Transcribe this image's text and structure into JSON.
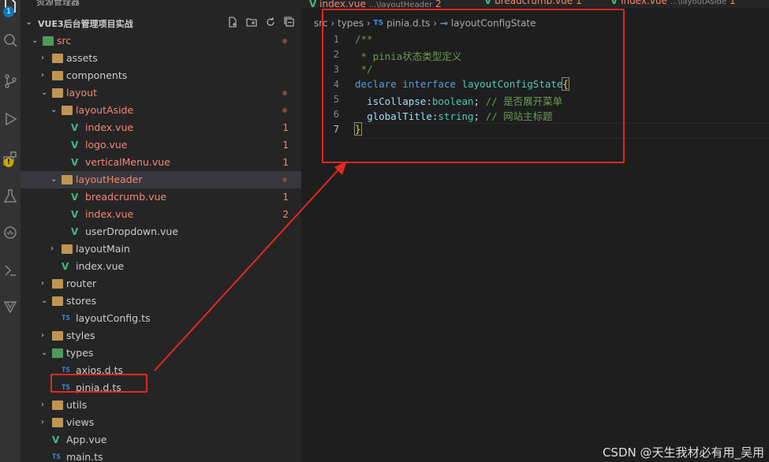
{
  "explorer": {
    "title": "资源管理器",
    "project": "VUE3后台管理项目实战",
    "activity_badge": "1"
  },
  "tabs": [
    {
      "name": "index.vue",
      "path": "...\\layoutHeader",
      "count": "2"
    },
    {
      "name": "breadcrumb.vue",
      "path": "",
      "count": "1"
    },
    {
      "name": "index.vue",
      "path": "...\\layoutAside",
      "count": "1"
    }
  ],
  "tree": [
    {
      "label": "src",
      "kind": "folder-src",
      "depth": 0,
      "open": true,
      "status": "dot",
      "color": "red"
    },
    {
      "label": "assets",
      "kind": "folder",
      "depth": 1,
      "open": false,
      "status": "",
      "color": "white"
    },
    {
      "label": "components",
      "kind": "folder",
      "depth": 1,
      "open": false,
      "status": "",
      "color": "white"
    },
    {
      "label": "layout",
      "kind": "folder",
      "depth": 1,
      "open": true,
      "status": "dot",
      "color": "red"
    },
    {
      "label": "layoutAside",
      "kind": "folder",
      "depth": 2,
      "open": true,
      "status": "dot",
      "color": "red"
    },
    {
      "label": "index.vue",
      "kind": "vue",
      "depth": 3,
      "status": "1",
      "color": "red"
    },
    {
      "label": "logo.vue",
      "kind": "vue",
      "depth": 3,
      "status": "1",
      "color": "red"
    },
    {
      "label": "verticalMenu.vue",
      "kind": "vue",
      "depth": 3,
      "status": "1",
      "color": "red"
    },
    {
      "label": "layoutHeader",
      "kind": "folder",
      "depth": 2,
      "open": true,
      "status": "dot",
      "color": "red",
      "selected": true
    },
    {
      "label": "breadcrumb.vue",
      "kind": "vue",
      "depth": 3,
      "status": "1",
      "color": "red"
    },
    {
      "label": "index.vue",
      "kind": "vue",
      "depth": 3,
      "status": "2",
      "color": "red"
    },
    {
      "label": "userDropdown.vue",
      "kind": "vue",
      "depth": 3,
      "status": "",
      "color": "white"
    },
    {
      "label": "layoutMain",
      "kind": "folder",
      "depth": 2,
      "open": false,
      "status": "",
      "color": "white"
    },
    {
      "label": "index.vue",
      "kind": "vue",
      "depth": 2,
      "status": "",
      "color": "white"
    },
    {
      "label": "router",
      "kind": "folder",
      "depth": 1,
      "open": false,
      "status": "",
      "color": "white"
    },
    {
      "label": "stores",
      "kind": "folder",
      "depth": 1,
      "open": true,
      "status": "",
      "color": "white"
    },
    {
      "label": "layoutConfig.ts",
      "kind": "ts",
      "depth": 2,
      "status": "",
      "color": "white"
    },
    {
      "label": "styles",
      "kind": "folder",
      "depth": 1,
      "open": false,
      "status": "",
      "color": "white"
    },
    {
      "label": "types",
      "kind": "folder-types",
      "depth": 1,
      "open": true,
      "status": "",
      "color": "white"
    },
    {
      "label": "axios.d.ts",
      "kind": "ts",
      "depth": 2,
      "status": "",
      "color": "white"
    },
    {
      "label": "pinia.d.ts",
      "kind": "ts",
      "depth": 2,
      "status": "",
      "color": "white",
      "highlighted": true
    },
    {
      "label": "utils",
      "kind": "folder",
      "depth": 1,
      "open": false,
      "status": "",
      "color": "white"
    },
    {
      "label": "views",
      "kind": "folder",
      "depth": 1,
      "open": false,
      "status": "",
      "color": "white"
    },
    {
      "label": "App.vue",
      "kind": "vue",
      "depth": 1,
      "status": "",
      "color": "white"
    },
    {
      "label": "main.ts",
      "kind": "ts",
      "depth": 1,
      "status": "",
      "color": "white"
    }
  ],
  "breadcrumb": {
    "parts": [
      "src",
      "types",
      "pinia.d.ts",
      "layoutConfigState"
    ],
    "file_icon": "TS"
  },
  "code": {
    "line_numbers": [
      "1",
      "2",
      "3",
      "4",
      "5",
      "6",
      "7"
    ],
    "l1": "/**",
    "l2": " * pinia状态类型定义",
    "l3": " */",
    "l4_kw1": "declare",
    "l4_kw2": "interface",
    "l4_name": "layoutConfigState",
    "l4_brace": "{",
    "l5_prop": "isCollapse",
    "l5_type": "boolean",
    "l5_comment": "// 是否展开菜单",
    "l6_prop": "globalTitle",
    "l6_type": "string",
    "l6_comment": "// 网站主标题",
    "l7_brace": "}"
  },
  "watermark": "CSDN @天生我材必有用_吴用",
  "colors": {
    "annotation": "#e2281f",
    "modified": "#f48771",
    "ts": "#3b8eea",
    "vue": "#41b883"
  }
}
